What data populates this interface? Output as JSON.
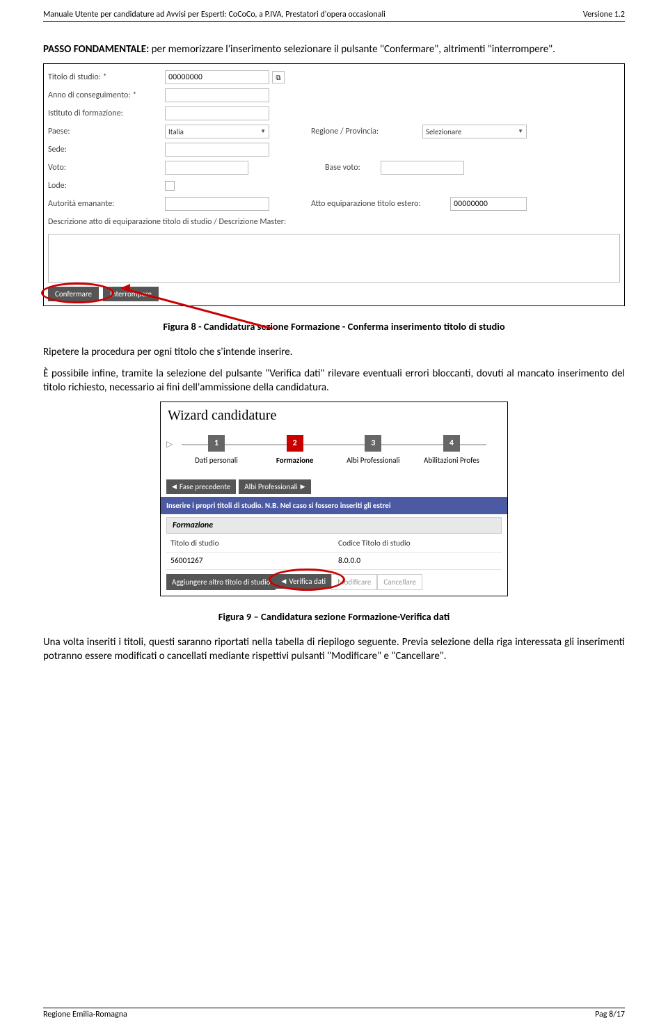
{
  "header": {
    "left": "Manuale Utente per candidature ad Avvisi per Esperti: CoCoCo, a P.IVA, Prestatori d'opera occasionali",
    "right": "Versione  1.2"
  },
  "intro": {
    "passo_strong": "PASSO FONDAMENTALE:",
    "passo_rest": " per memorizzare l'inserimento selezionare il pulsante \"Confermare\", altrimenti \"interrompere\"."
  },
  "form": {
    "labels": {
      "titolo": "Titolo di studio:",
      "anno": "Anno di conseguimento:",
      "istituto": "Istituto di formazione:",
      "paese": "Paese:",
      "sede": "Sede:",
      "voto": "Voto:",
      "lode": "Lode:",
      "autorita": "Autorità emanante:",
      "descrizione": "Descrizione atto di equiparazione titolo di studio / Descrizione Master:",
      "regione": "Regione / Provincia:",
      "basevoto": "Base voto:",
      "attoeq": "Atto equiparazione titolo estero:"
    },
    "values": {
      "titolo": "00000000",
      "paese": "Italia",
      "regione_sel": "Selezionare",
      "attoeq": "00000000"
    },
    "buttons": {
      "confermare": "Confermare",
      "interrompere": "Interrompere"
    },
    "lookup_icon": "⧉"
  },
  "captions": {
    "fig8": "Figura 8 - Candidatura sezione Formazione - Conferma inserimento titolo di studio",
    "fig9": "Figura 9 – Candidatura sezione Formazione-Verifica dati"
  },
  "text": {
    "ripetere": "Ripetere la procedura per ogni titolo che s'intende inserire.",
    "possibile": "È possibile infine, tramite la selezione del pulsante \"Verifica dati\" rilevare eventuali errori bloccanti, dovuti al mancato inserimento del titolo richiesto, necessario ai fini dell'ammissione della candidatura.",
    "una_volta": "Una volta inseriti i titoli, questi saranno riportati nella tabella di riepilogo seguente. Previa selezione della riga interessata gli inserimenti potranno essere modificati o cancellati mediante rispettivi pulsanti \"Modificare\" e \"Cancellare\"."
  },
  "wizard": {
    "title": "Wizard candidature",
    "steps": [
      {
        "num": "1",
        "label": "Dati personali"
      },
      {
        "num": "2",
        "label": "Formazione"
      },
      {
        "num": "3",
        "label": "Albi Professionali"
      },
      {
        "num": "4",
        "label": "Abilitazioni Profes"
      }
    ],
    "phase_prev": "Fase precedente",
    "phase_next": "Albi Professionali",
    "blue_text": "Inserire i propri titoli di studio. N.B. Nel caso si fossero inseriti gli estrei",
    "section_header": "Formazione",
    "table": {
      "col1": "Titolo di studio",
      "col2": "Codice Titolo di studio",
      "row1c1": "56001267",
      "row1c2": "8.0.0.0"
    },
    "actions": {
      "add": "Aggiungere altro titolo di studio",
      "verify": "Verifica dati",
      "modify": "Modificare",
      "delete": "Cancellare"
    }
  },
  "footer": {
    "left": "Regione Emilia-Romagna",
    "right": "Pag 8/17"
  }
}
